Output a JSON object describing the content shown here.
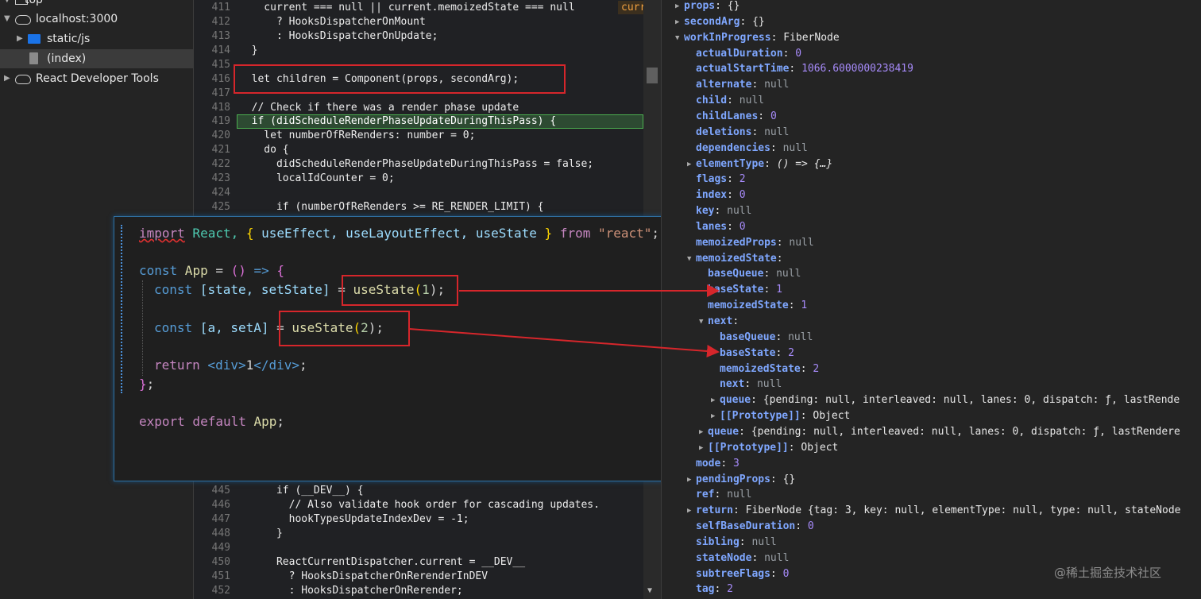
{
  "tree": {
    "top": "top",
    "host": "localhost:3000",
    "folder": "static/js",
    "file": "(index)",
    "react_tools": "React Developer Tools"
  },
  "editor": {
    "lines": [
      {
        "n": "411",
        "t": "    current === null || current.memoizedState === null"
      },
      {
        "n": "412",
        "t": "      ? HooksDispatcherOnMount"
      },
      {
        "n": "413",
        "t": "      : HooksDispatcherOnUpdate;"
      },
      {
        "n": "414",
        "t": "  }"
      },
      {
        "n": "415",
        "t": ""
      },
      {
        "n": "416",
        "t": "  let children = Component(props, secondArg);"
      },
      {
        "n": "417",
        "t": ""
      },
      {
        "n": "418",
        "t": "  // Check if there was a render phase update"
      },
      {
        "n": "419",
        "t": "  if (didScheduleRenderPhaseUpdateDuringThisPass) {"
      },
      {
        "n": "420",
        "t": "    let numberOfReRenders: number = 0;"
      },
      {
        "n": "421",
        "t": "    do {"
      },
      {
        "n": "422",
        "t": "      didScheduleRenderPhaseUpdateDuringThisPass = false;"
      },
      {
        "n": "423",
        "t": "      localIdCounter = 0;"
      },
      {
        "n": "424",
        "t": ""
      },
      {
        "n": "425",
        "t": "      if (numberOfReRenders >= RE_RENDER_LIMIT) {"
      },
      {
        "n": "444",
        "t": ""
      },
      {
        "n": "445",
        "t": "      if (__DEV__) {"
      },
      {
        "n": "446",
        "t": "        // Also validate hook order for cascading updates."
      },
      {
        "n": "447",
        "t": "        hookTypesUpdateIndexDev = -1;"
      },
      {
        "n": "448",
        "t": "      }"
      },
      {
        "n": "449",
        "t": ""
      },
      {
        "n": "450",
        "t": "      ReactCurrentDispatcher.current = __DEV__"
      },
      {
        "n": "451",
        "t": "        ? HooksDispatcherOnRerenderInDEV"
      },
      {
        "n": "452",
        "t": "        : HooksDispatcherOnRerender;"
      }
    ],
    "inline_tag": "curr"
  },
  "overlay": {
    "l1": {
      "a": "import",
      "b": " React, ",
      "c": "{",
      "d": " useEffect, useLayoutEffect, useState ",
      "e": "}",
      "f": " from ",
      "g": "\"react\"",
      "h": ";"
    },
    "l2": {
      "a": "const",
      "b": " App",
      "c": " = ",
      "d": "()",
      "e": " => ",
      "f": "{"
    },
    "l3": {
      "a": "const",
      "b": " [state, setState]",
      "c": " = ",
      "d": "useState",
      "e": "(",
      "f": "1",
      "g": ");"
    },
    "l4": {
      "a": "const",
      "b": " [a, setA]",
      "c": " = ",
      "d": "useState",
      "e": "(",
      "f": "2",
      "g": ");"
    },
    "l5": {
      "a": "return",
      "b": " <div>",
      "c": "1",
      "d": "</div>",
      "e": ";"
    },
    "l6": {
      "a": "}",
      "b": ";"
    },
    "l7": {
      "a": "export",
      "b": " default",
      "c": " App",
      "d": ";"
    }
  },
  "props": {
    "rows": [
      {
        "k": "props",
        "v": "{}",
        "tw": true
      },
      {
        "k": "secondArg",
        "v": "{}",
        "tw": true
      },
      {
        "k": "workInProgress",
        "v": "FiberNode",
        "tw": true,
        "open": true
      },
      {
        "k": "actualDuration",
        "v": "0"
      },
      {
        "k": "actualStartTime",
        "v": "1066.6000000238419"
      },
      {
        "k": "alternate",
        "v": "null"
      },
      {
        "k": "child",
        "v": "null"
      },
      {
        "k": "childLanes",
        "v": "0"
      },
      {
        "k": "deletions",
        "v": "null"
      },
      {
        "k": "dependencies",
        "v": "null"
      },
      {
        "k": "elementType",
        "v": "() => {…}",
        "tw": true
      },
      {
        "k": "flags",
        "v": "2"
      },
      {
        "k": "index",
        "v": "0"
      },
      {
        "k": "key",
        "v": "null"
      },
      {
        "k": "lanes",
        "v": "0"
      },
      {
        "k": "memoizedProps",
        "v": "null"
      },
      {
        "k": "memoizedState",
        "v": "",
        "tw": true,
        "open": true
      },
      {
        "k": "baseQueue",
        "v": "null"
      },
      {
        "k": "baseState",
        "v": "1"
      },
      {
        "k": "memoizedState",
        "v": "1"
      },
      {
        "k": "next",
        "v": "",
        "tw": true,
        "open": true
      },
      {
        "k": "baseQueue",
        "v": "null"
      },
      {
        "k": "baseState",
        "v": "2"
      },
      {
        "k": "memoizedState",
        "v": "2"
      },
      {
        "k": "next",
        "v": "null"
      },
      {
        "k": "queue",
        "v": "{pending: null, interleaved: null, lanes: 0, dispatch: ƒ, lastRende",
        "tw": true
      },
      {
        "k": "[[Prototype]]",
        "v": "Object",
        "tw": true
      },
      {
        "k": "queue",
        "v": "{pending: null, interleaved: null, lanes: 0, dispatch: ƒ, lastRendere",
        "tw": true
      },
      {
        "k": "[[Prototype]]",
        "v": "Object",
        "tw": true
      },
      {
        "k": "mode",
        "v": "3"
      },
      {
        "k": "pendingProps",
        "v": "{}",
        "tw": true
      },
      {
        "k": "ref",
        "v": "null"
      },
      {
        "k": "return",
        "v": "FiberNode {tag: 3, key: null, elementType: null, type: null, stateNode",
        "tw": true
      },
      {
        "k": "selfBaseDuration",
        "v": "0"
      },
      {
        "k": "sibling",
        "v": "null"
      },
      {
        "k": "stateNode",
        "v": "null"
      },
      {
        "k": "subtreeFlags",
        "v": "0"
      },
      {
        "k": "tag",
        "v": "2"
      }
    ]
  },
  "watermark": "@稀土掘金技术社区"
}
